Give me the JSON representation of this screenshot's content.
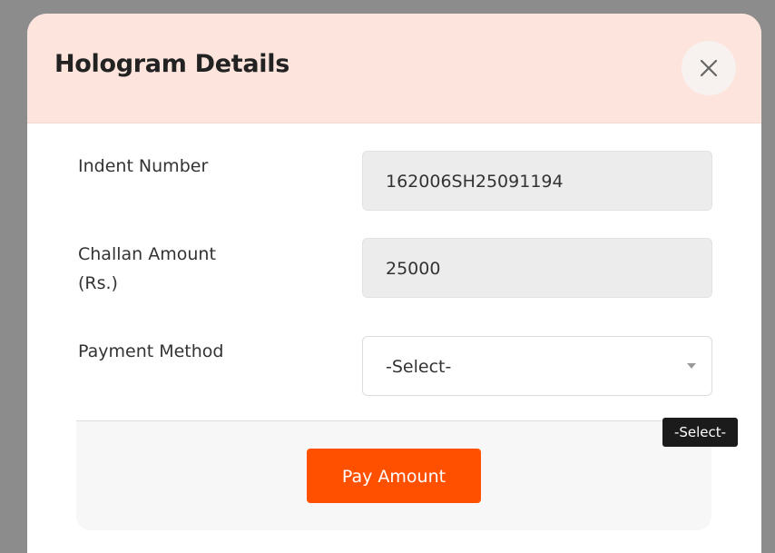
{
  "dialog": {
    "title": "Hologram Details",
    "close_icon": "close-icon"
  },
  "fields": {
    "indent_number": {
      "label": "Indent Number",
      "value": "162006SH25091194"
    },
    "challan_amount": {
      "label_line1": "Challan Amount",
      "label_line2": "(Rs.)",
      "value": "25000"
    },
    "payment_method": {
      "label": "Payment Method",
      "selected": "-Select-"
    }
  },
  "tooltip": {
    "text": "-Select-"
  },
  "footer": {
    "pay_button_label": "Pay Amount"
  },
  "colors": {
    "header_bg": "#fde5dd",
    "pay_button": "#ff5000",
    "readonly_bg": "#ececec",
    "tooltip_bg": "#1b1b1b"
  }
}
